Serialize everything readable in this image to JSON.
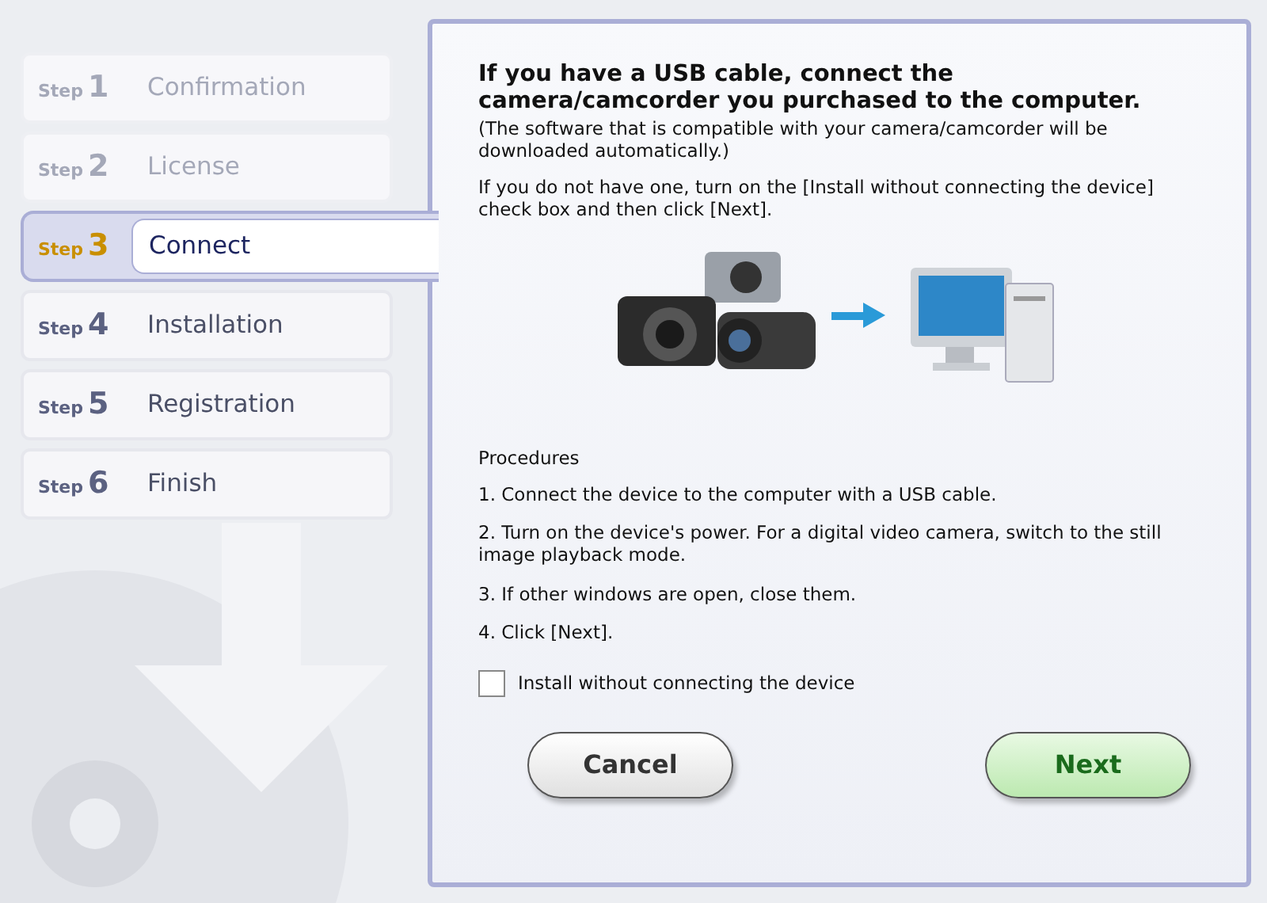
{
  "steps": [
    {
      "step": "Step",
      "number": "1",
      "title": "Confirmation",
      "completed": true,
      "selected": false
    },
    {
      "step": "Step",
      "number": "2",
      "title": "License",
      "completed": true,
      "selected": false
    },
    {
      "step": "Step",
      "number": "3",
      "title": "Connect",
      "completed": false,
      "selected": true
    },
    {
      "step": "Step",
      "number": "4",
      "title": "Installation",
      "completed": false,
      "selected": false
    },
    {
      "step": "Step",
      "number": "5",
      "title": "Registration",
      "completed": false,
      "selected": false
    },
    {
      "step": "Step",
      "number": "6",
      "title": "Finish",
      "completed": false,
      "selected": false
    }
  ],
  "heading": "If you have a USB cable, connect the camera/camcorder you purchased to the computer.",
  "note": "(The software that is compatible with your camera/camcorder will be downloaded automatically.)",
  "instruction": "If you do not have one, turn on the [Install without connecting the device] check box and then click [Next].",
  "procedures_title": "Procedures",
  "procedures": [
    "1. Connect the device to the computer with a USB cable.",
    "2. Turn on the device's power. For a digital video camera, switch to the still image playback mode.",
    "3. If other windows are open, close them.",
    "4. Click [Next]."
  ],
  "checkbox": {
    "label": "Install without connecting the device",
    "checked": false
  },
  "buttons": [
    {
      "label": "Cancel",
      "kind": "secondary"
    },
    {
      "label": "Next",
      "kind": "primary"
    }
  ]
}
